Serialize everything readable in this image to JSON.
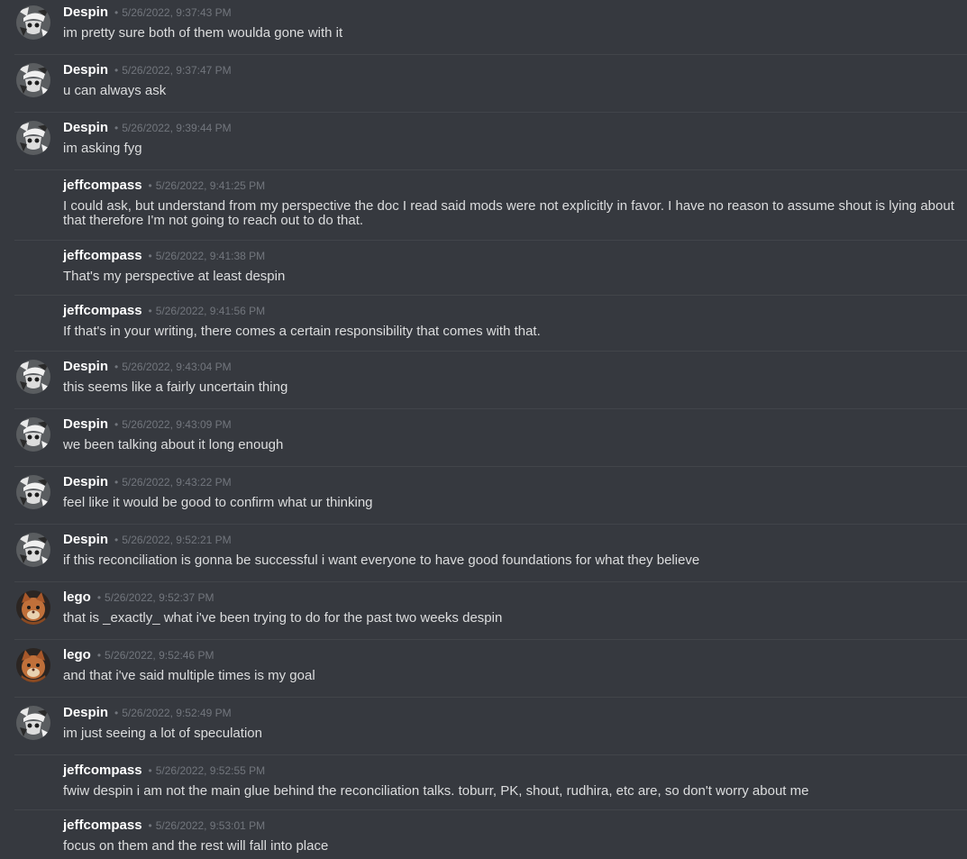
{
  "users": {
    "despin": {
      "name": "Despin",
      "avatar_icon": "despin-avatar-icon"
    },
    "jeff": {
      "name": "jeffcompass"
    },
    "lego": {
      "name": "lego",
      "avatar_icon": "lego-avatar-icon"
    }
  },
  "colors": {
    "background": "#36393f",
    "username": "#ffffff",
    "timestamp": "#72767d",
    "text": "#dcddde",
    "divider": "#42454a"
  },
  "messages": [
    {
      "author": "Despin",
      "timestamp": "5/26/2022, 9:37:43 PM",
      "text": "im pretty sure both of them woulda gone with it"
    },
    {
      "author": "Despin",
      "timestamp": "5/26/2022, 9:37:47 PM",
      "text": "u can always ask"
    },
    {
      "author": "Despin",
      "timestamp": "5/26/2022, 9:39:44 PM",
      "text": "im asking fyg"
    },
    {
      "author": "jeffcompass",
      "timestamp": "5/26/2022, 9:41:25 PM",
      "text": "I could ask, but understand from my perspective the doc I read said mods were not explicitly in favor. I have no reason to assume shout is lying about that therefore I'm not going to reach out to do that."
    },
    {
      "author": "jeffcompass",
      "timestamp": "5/26/2022, 9:41:38 PM",
      "text": "That's my perspective at least despin"
    },
    {
      "author": "jeffcompass",
      "timestamp": "5/26/2022, 9:41:56 PM",
      "text": "If that's in your writing, there comes a certain responsibility that comes with that."
    },
    {
      "author": "Despin",
      "timestamp": "5/26/2022, 9:43:04 PM",
      "text": "this seems like a fairly uncertain thing"
    },
    {
      "author": "Despin",
      "timestamp": "5/26/2022, 9:43:09 PM",
      "text": "we been talking about it long enough"
    },
    {
      "author": "Despin",
      "timestamp": "5/26/2022, 9:43:22 PM",
      "text": "feel like it would be good to confirm what ur thinking"
    },
    {
      "author": "Despin",
      "timestamp": "5/26/2022, 9:52:21 PM",
      "text": "if this reconciliation is gonna be successful i want everyone to have good foundations for what they believe"
    },
    {
      "author": "lego",
      "timestamp": "5/26/2022, 9:52:37 PM",
      "text": "that is _exactly_ what i've been trying to do for the past two weeks despin"
    },
    {
      "author": "lego",
      "timestamp": "5/26/2022, 9:52:46 PM",
      "text": "and that i've said multiple times is my goal"
    },
    {
      "author": "Despin",
      "timestamp": "5/26/2022, 9:52:49 PM",
      "text": "im just seeing a lot of speculation"
    },
    {
      "author": "jeffcompass",
      "timestamp": "5/26/2022, 9:52:55 PM",
      "text": "fwiw despin i am not the main glue behind the reconciliation talks. toburr, PK, shout, rudhira, etc are, so don't worry about me"
    },
    {
      "author": "jeffcompass",
      "timestamp": "5/26/2022, 9:53:01 PM",
      "text": "focus on them and the rest will fall into place"
    }
  ]
}
